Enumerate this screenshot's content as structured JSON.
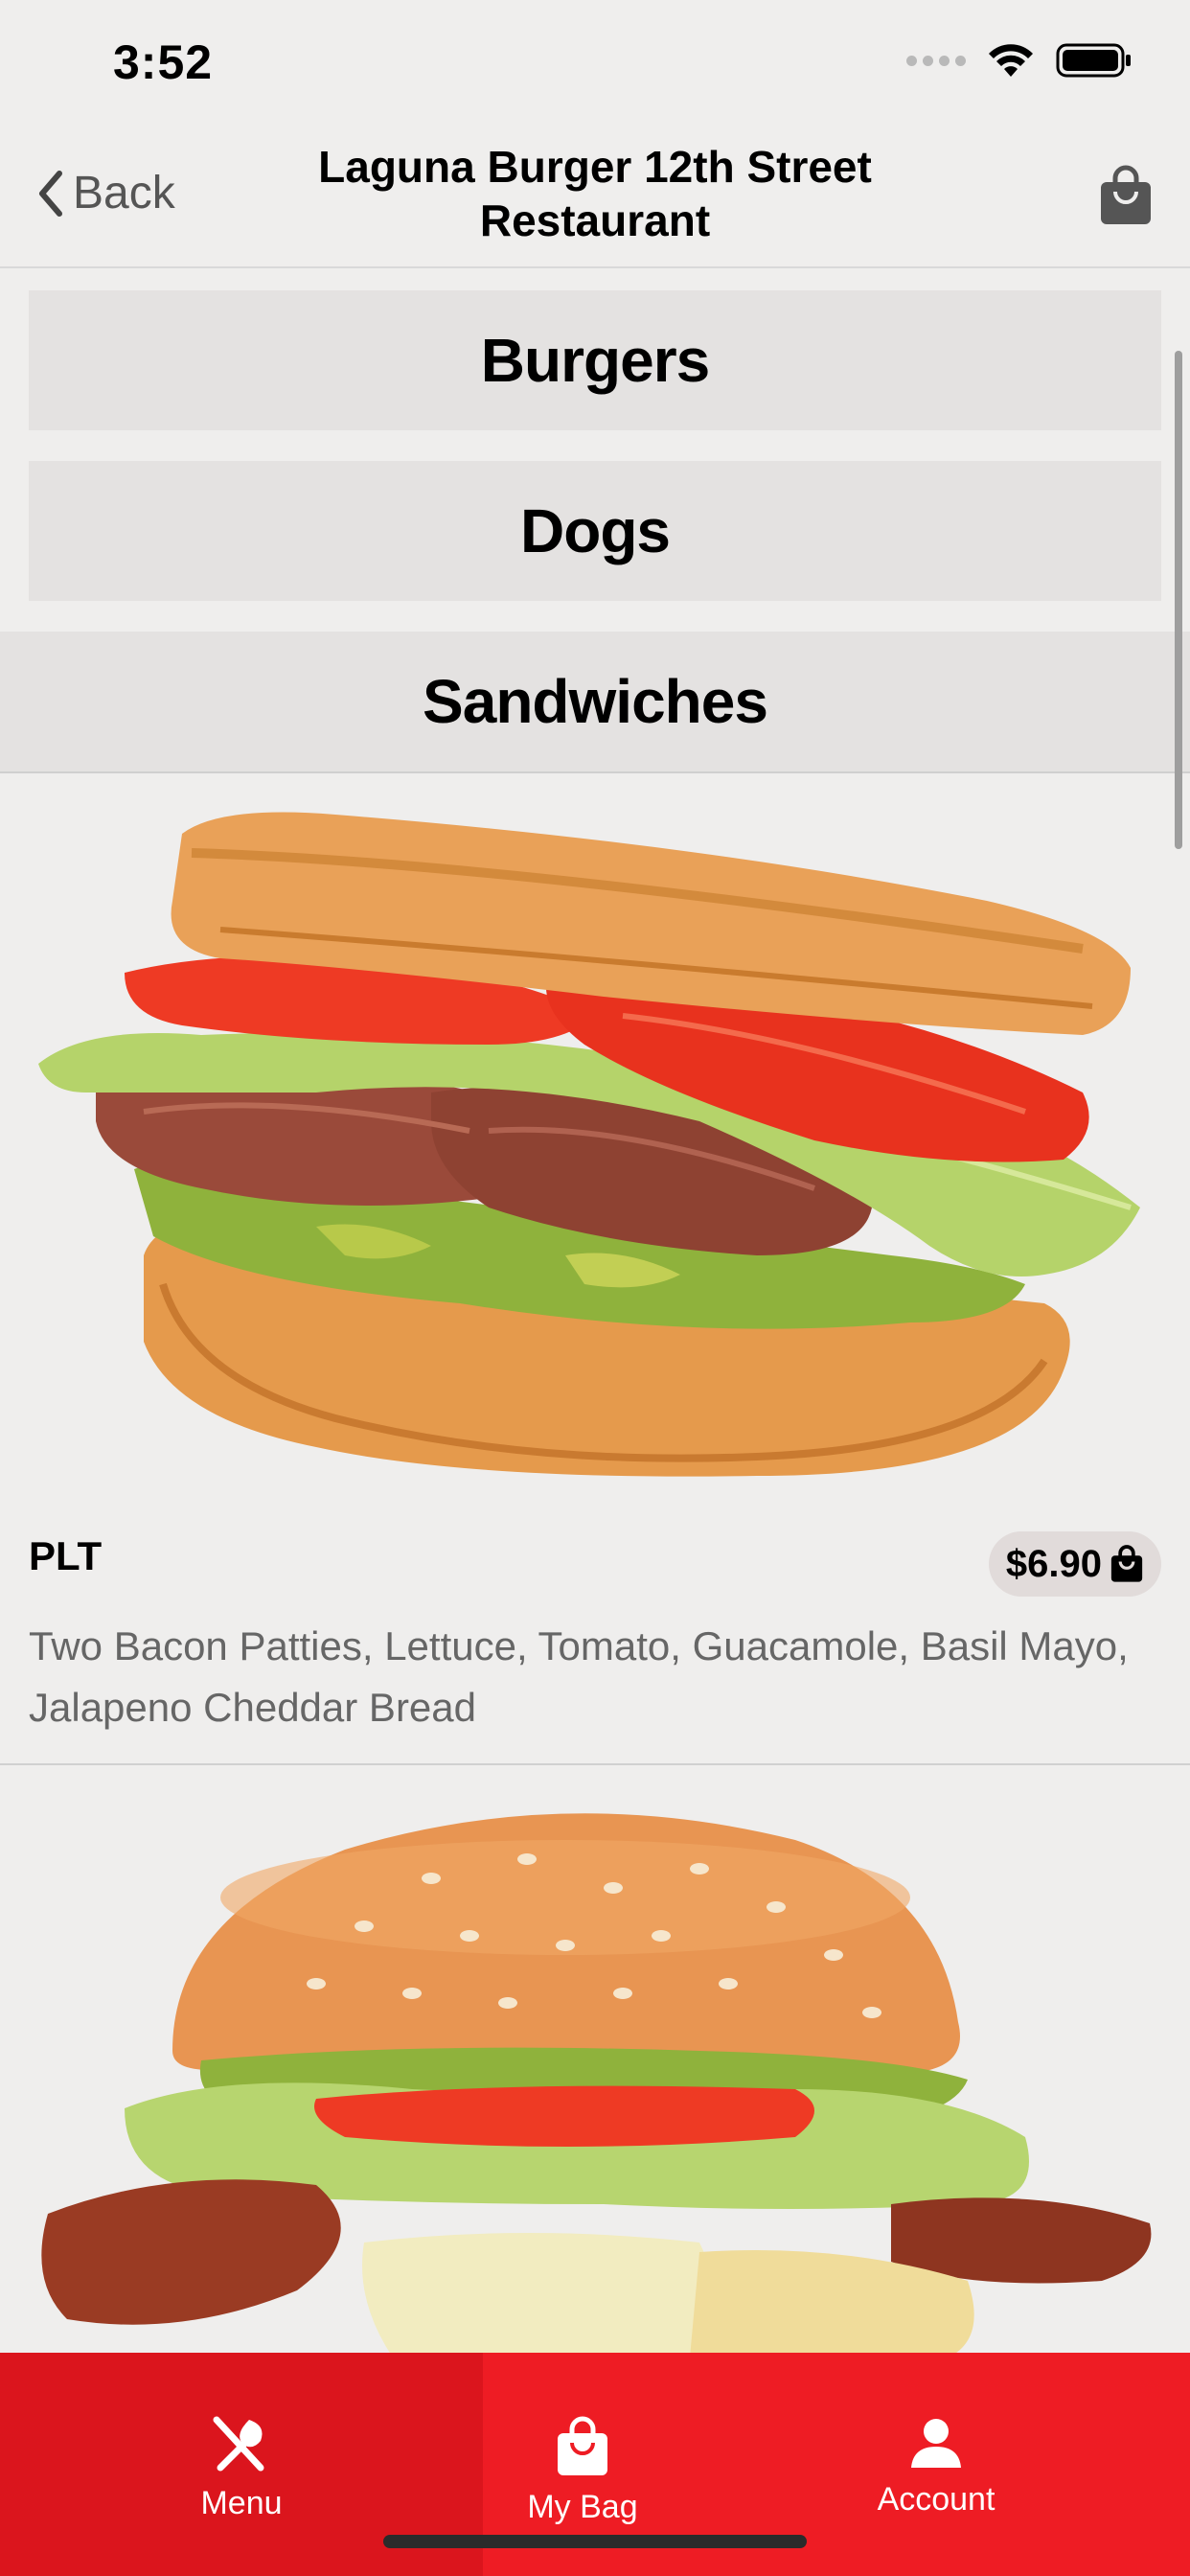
{
  "status_bar": {
    "time": "3:52"
  },
  "nav": {
    "back_label": "Back",
    "title": "Laguna Burger 12th Street Restaurant"
  },
  "categories": [
    {
      "label": "Burgers"
    },
    {
      "label": "Dogs"
    },
    {
      "label": "Sandwiches"
    }
  ],
  "items": [
    {
      "name": "PLT",
      "price": "$6.90",
      "description": "Two Bacon Patties, Lettuce, Tomato, Guacamole, Basil Mayo, Jalapeno Cheddar Bread"
    }
  ],
  "tab_bar": {
    "tabs": [
      {
        "label": "Menu",
        "icon": "utensils-icon"
      },
      {
        "label": "My Bag",
        "icon": "bag-icon"
      },
      {
        "label": "Account",
        "icon": "person-icon"
      }
    ]
  },
  "colors": {
    "accent": "#ee1c24",
    "background": "#efeeed"
  }
}
